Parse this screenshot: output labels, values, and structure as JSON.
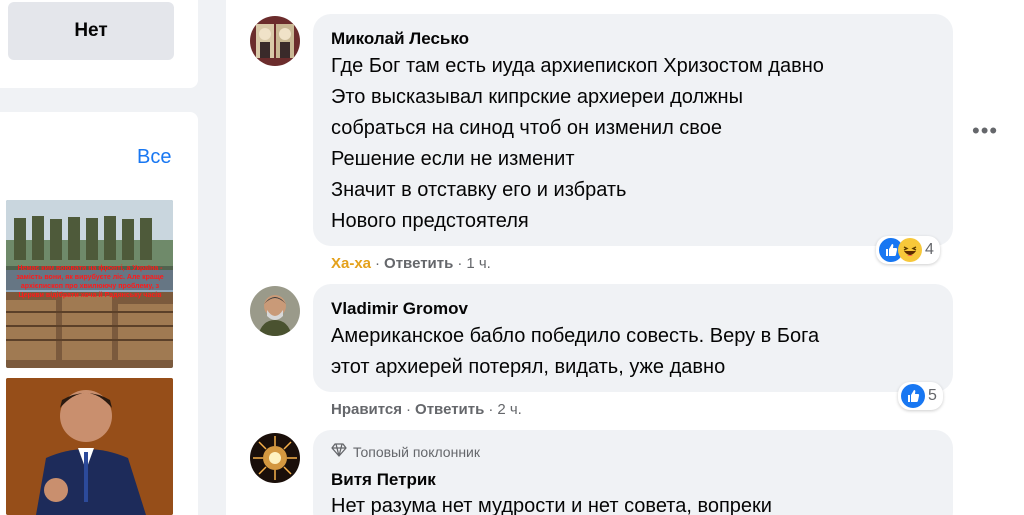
{
  "left": {
    "no_button": "Нет",
    "all_link": "Все",
    "thumb1_caption": "Немає ким воювати на фронті, а Україна - замість вони, як вирубуєте ліс. Але краще архієпископ про хвилюючу проблему, з Церкви відібрати хоча й Радянську часів"
  },
  "comments": [
    {
      "author": "Миколай Лесько",
      "lines": [
        "Где Бог там есть иуда архиепископ Хризостом давно",
        "Это высказывал кипрские архиереи должны",
        "собраться на синод чтоб он изменил свое",
        "Решение если не изменит",
        "Значит в отставку его и избрать",
        "Нового предстоятеля"
      ],
      "reaction_label": "Ха-ха",
      "reply_label": "Ответить",
      "time": "1 ч.",
      "reaction_count": "4"
    },
    {
      "author": "Vladimir Gromov",
      "lines": [
        "Американское бабло победило совесть. Веру в Бога",
        "этот архиерей потерял, видать, уже давно"
      ],
      "reaction_label": "Нравится",
      "reply_label": "Ответить",
      "time": "2 ч.",
      "reaction_count": "5"
    },
    {
      "badge": "Топовый поклонник",
      "author": "Витя Петрик",
      "lines": [
        "Нет разума нет мудрости и нет совета, вопреки"
      ]
    }
  ],
  "separator": "·",
  "more_options": "•••",
  "colors": {
    "accent": "#1877f2",
    "haha": "#e4a11b",
    "bubble": "#f0f2f5"
  }
}
